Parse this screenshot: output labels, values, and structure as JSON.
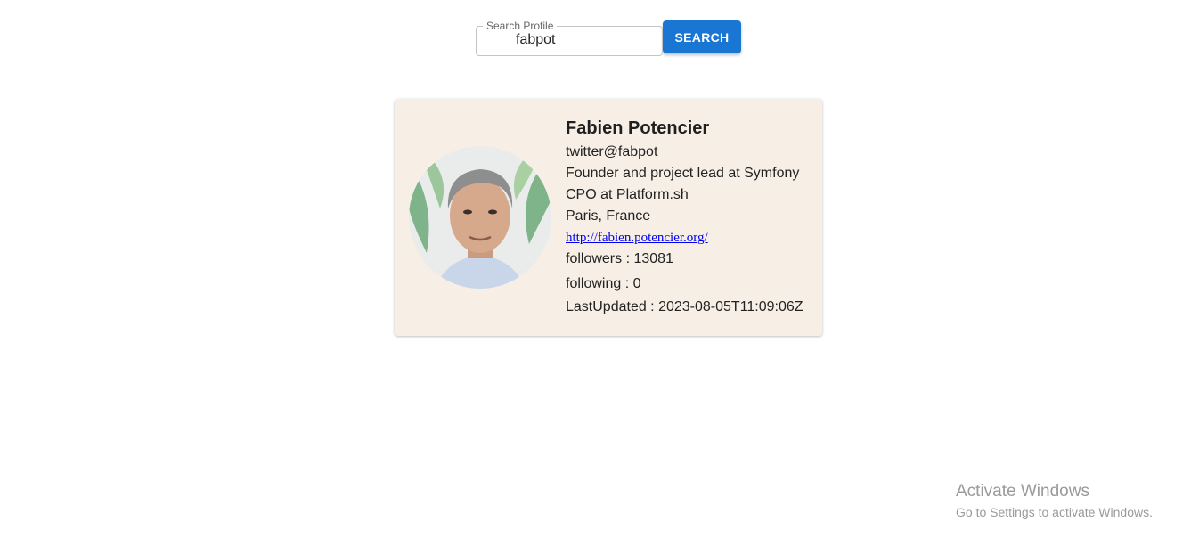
{
  "search": {
    "label": "Search Profile",
    "value": "fabpot",
    "button_label": "SEARCH"
  },
  "profile": {
    "name": "Fabien Potencier",
    "twitter": "twitter@fabpot",
    "bio_line1": "Founder and project lead at Symfony",
    "bio_line2": "CPO at Platform.sh",
    "location": "Paris, France",
    "blog": "http://fabien.potencier.org/",
    "followers": "followers : 13081",
    "following": "following : 0",
    "last_updated": "LastUpdated : 2023-08-05T11:09:06Z",
    "avatar_icon": "user-avatar-photo"
  },
  "watermark": {
    "title": "Activate Windows",
    "subtitle": "Go to Settings to activate Windows."
  },
  "colors": {
    "accent": "#1976d2",
    "card_bg": "#f7efe6",
    "link": "#0000ee"
  }
}
